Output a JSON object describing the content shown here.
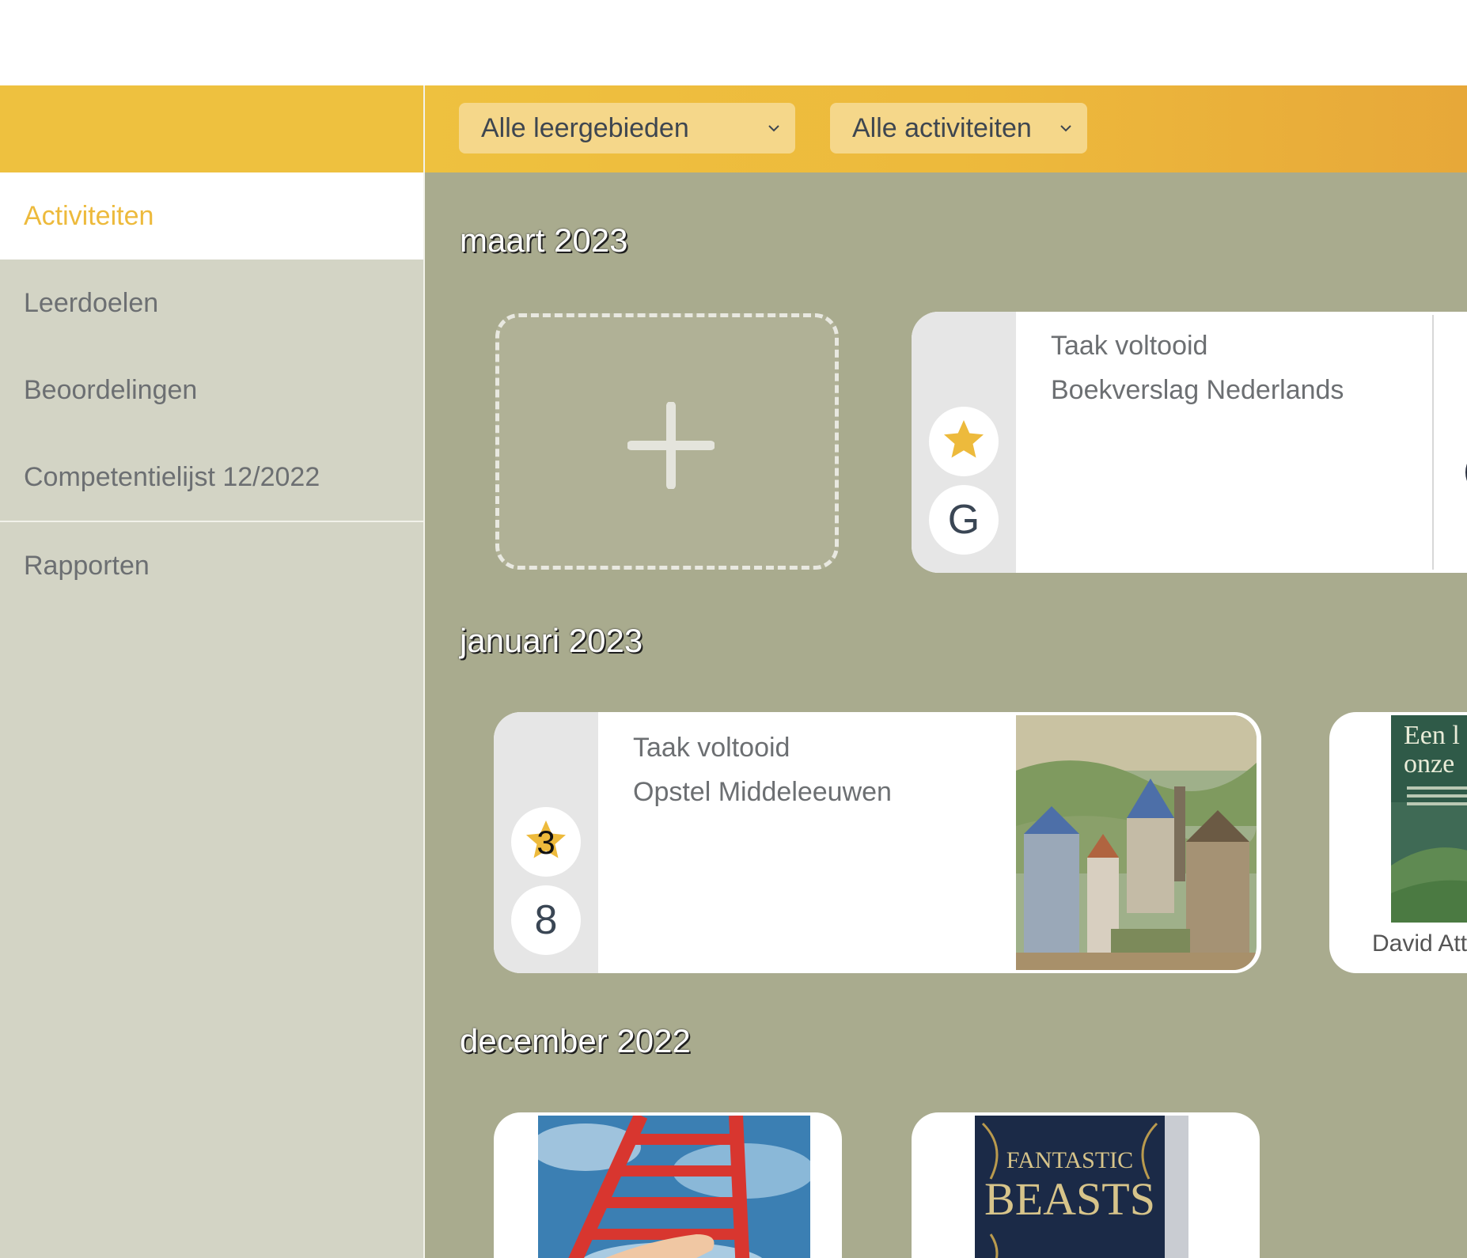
{
  "filters": {
    "learning_areas": "Alle leergebieden",
    "activities": "Alle activiteiten"
  },
  "sidebar": {
    "items": [
      {
        "label": "Activiteiten",
        "active": true
      },
      {
        "label": "Leerdoelen"
      },
      {
        "label": "Beoordelingen"
      },
      {
        "label": "Competentielijst 12/2022"
      },
      {
        "label": "Rapporten"
      }
    ]
  },
  "timeline": {
    "months": [
      "maart 2023",
      "januari 2023",
      "december 2022"
    ],
    "cards": [
      {
        "title": "Taak voltooid",
        "subtitle": "Boekverslag Nederlands",
        "grade": "G",
        "star_icon": "star-icon"
      },
      {
        "title": "Taak voltooid",
        "subtitle": "Opstel Middeleeuwen",
        "grade": "8",
        "star_count": "3"
      },
      {
        "cover_text_line1": "Een l",
        "cover_text_line2": "onze",
        "author": "David Att"
      },
      {
        "image": "ladder-hand-image"
      },
      {
        "cover_text_line1": "FANTASTIC",
        "cover_text_line2": "BEASTS"
      }
    ]
  },
  "colors": {
    "accent": "#EDBA3C",
    "main_bg": "#A9AB8E",
    "sidebar_bg": "#D3D4C5"
  }
}
